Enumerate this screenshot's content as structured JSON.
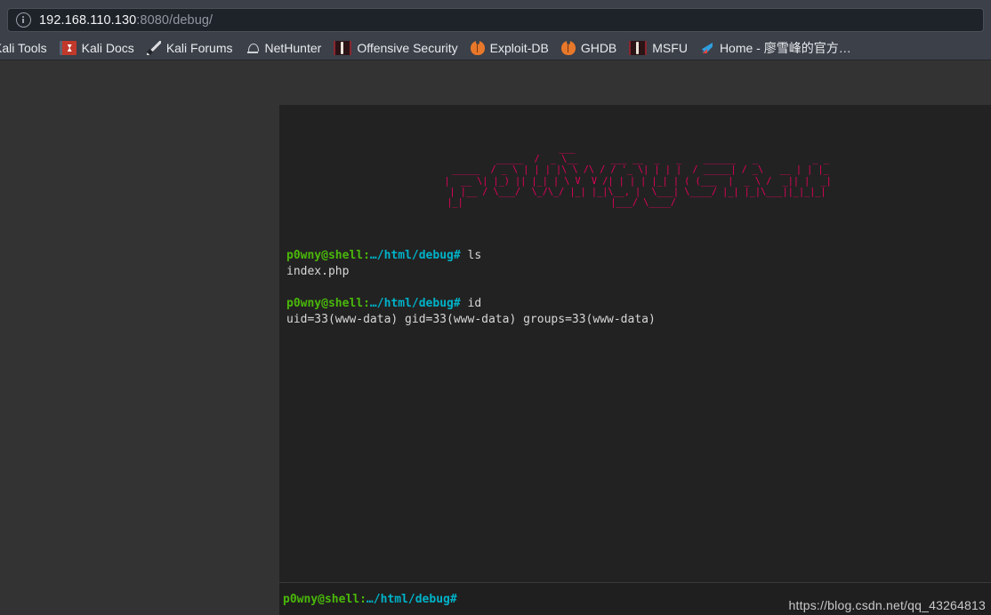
{
  "browser": {
    "urlbar": {
      "info_icon": "info-circle-icon",
      "host": "192.168.110.130",
      "rest": ":8080/debug/",
      "full_url": "192.168.110.130:8080/debug/"
    },
    "bookmarks": [
      {
        "label": "Kali Tools",
        "icon": "kali-tools-icon"
      },
      {
        "label": "Kali Docs",
        "icon": "kali-docs-icon"
      },
      {
        "label": "Kali Forums",
        "icon": "kali-forums-icon"
      },
      {
        "label": "NetHunter",
        "icon": "nethunter-icon"
      },
      {
        "label": "Offensive Security",
        "icon": "offensive-security-icon"
      },
      {
        "label": "Exploit-DB",
        "icon": "exploit-db-bug-icon"
      },
      {
        "label": "GHDB",
        "icon": "ghdb-bug-icon"
      },
      {
        "label": "MSFU",
        "icon": "msfu-icon"
      },
      {
        "label": "Home - 廖雪峰的官方…",
        "icon": "rocket-icon"
      }
    ]
  },
  "shell": {
    "banner": "                    ___                                             \n          _____  /  _ \\__      ___ __  _   _    ______   _          _ _\n  _____  / _ \\ | | | |\\ \\ /\\ / / '_ \\| | | |  / _____| / _\\   __ | | |_\n |  __ \\| |_) || |_| | \\ V  V /| | | | |_| | ( (___  |  _ \\ /  _|| |  _|\n | |__ / \\___/  \\_/\\_/ |_| |_|\\__, |  \\___| \\____/ |_| |_|\\___||_|_|_|\n |_|                           |___/ \\____/                            ",
    "banner_title": "p0wny@shell ascii art banner",
    "prompt": {
      "user": "p0wny@shell",
      "separator": ":",
      "path": "…/html/debug",
      "hash": "#"
    },
    "history": [
      {
        "prompt_user": "p0wny@shell",
        "prompt_sep": ":",
        "prompt_path": "…/html/debug",
        "prompt_hash": "#",
        "command": " ls",
        "output": "index.php"
      },
      {
        "prompt_user": "p0wny@shell",
        "prompt_sep": ":",
        "prompt_path": "…/html/debug",
        "prompt_hash": "#",
        "command": " id",
        "output": "uid=33(www-data) gid=33(www-data) groups=33(www-data)"
      }
    ],
    "input": {
      "value": "",
      "placeholder": ""
    }
  },
  "watermark": "https://blog.csdn.net/qq_43264813",
  "colors": {
    "page_background": "#333333",
    "terminal_background": "#222222",
    "toolbar_background": "#3b4049",
    "urlbar_background": "#1e2229",
    "banner_pink": "#e6005a",
    "prompt_green": "#4ab80a",
    "prompt_cyan": "#00b2c8",
    "terminal_text": "#d7d7d7"
  }
}
